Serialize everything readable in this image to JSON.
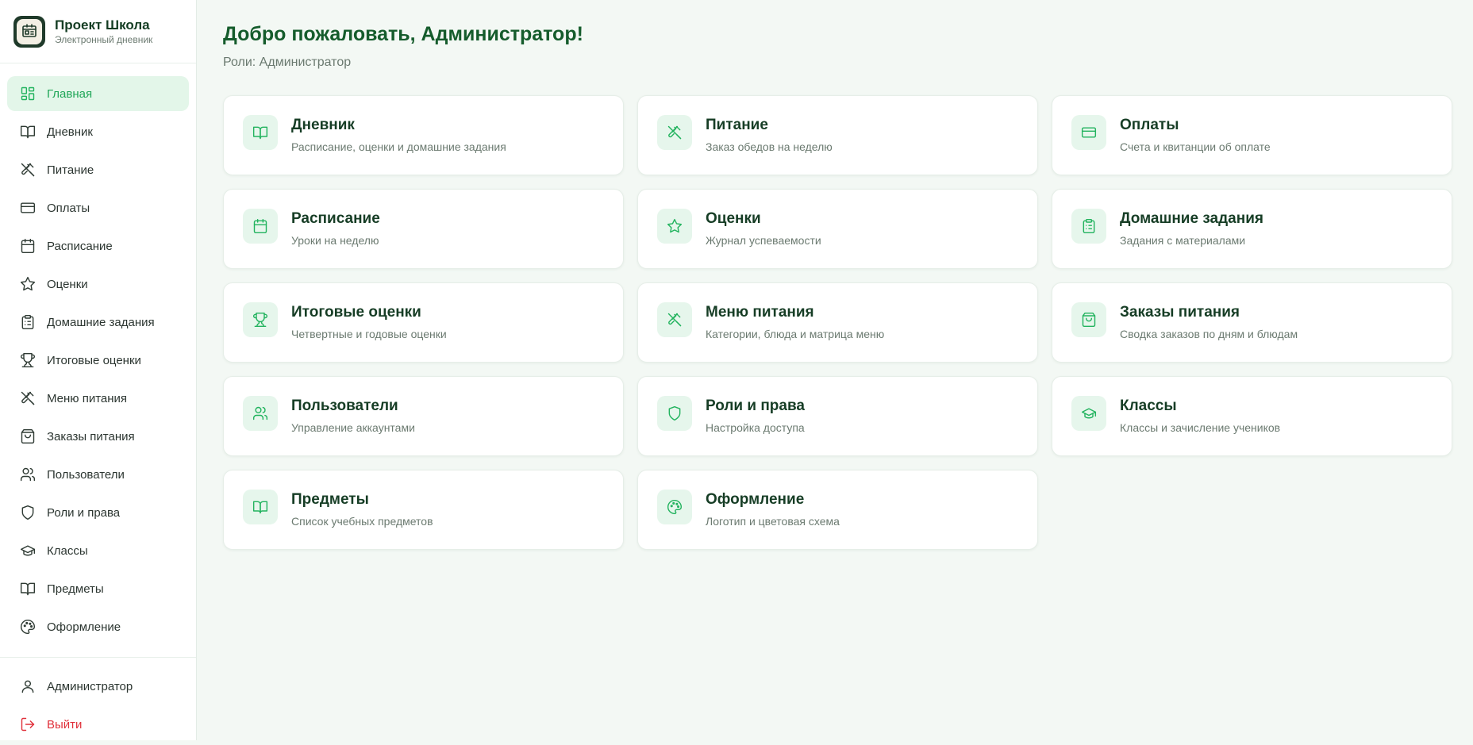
{
  "brand": {
    "title": "Проект Школа",
    "subtitle": "Электронный дневник"
  },
  "sidebar": {
    "items": [
      {
        "label": "Главная",
        "icon": "dashboard-icon",
        "active": true
      },
      {
        "label": "Дневник",
        "icon": "book-icon"
      },
      {
        "label": "Питание",
        "icon": "utensils-icon"
      },
      {
        "label": "Оплаты",
        "icon": "credit-card-icon"
      },
      {
        "label": "Расписание",
        "icon": "calendar-icon"
      },
      {
        "label": "Оценки",
        "icon": "star-icon"
      },
      {
        "label": "Домашние задания",
        "icon": "clipboard-icon"
      },
      {
        "label": "Итоговые оценки",
        "icon": "trophy-icon"
      },
      {
        "label": "Меню питания",
        "icon": "utensils-icon"
      },
      {
        "label": "Заказы питания",
        "icon": "shopping-bag-icon"
      },
      {
        "label": "Пользователи",
        "icon": "users-icon"
      },
      {
        "label": "Роли и права",
        "icon": "shield-icon"
      },
      {
        "label": "Классы",
        "icon": "graduation-cap-icon"
      },
      {
        "label": "Предметы",
        "icon": "book-icon"
      },
      {
        "label": "Оформление",
        "icon": "palette-icon"
      }
    ],
    "user_label": "Администратор",
    "logout_label": "Выйти"
  },
  "main": {
    "title": "Добро пожаловать, Администратор!",
    "roles": "Роли: Администратор",
    "cards": [
      {
        "title": "Дневник",
        "desc": "Расписание, оценки и домашние задания",
        "icon": "book-icon"
      },
      {
        "title": "Питание",
        "desc": "Заказ обедов на неделю",
        "icon": "utensils-icon"
      },
      {
        "title": "Оплаты",
        "desc": "Счета и квитанции об оплате",
        "icon": "credit-card-icon"
      },
      {
        "title": "Расписание",
        "desc": "Уроки на неделю",
        "icon": "calendar-icon"
      },
      {
        "title": "Оценки",
        "desc": "Журнал успеваемости",
        "icon": "star-icon"
      },
      {
        "title": "Домашние задания",
        "desc": "Задания с материалами",
        "icon": "clipboard-icon"
      },
      {
        "title": "Итоговые оценки",
        "desc": "Четвертные и годовые оценки",
        "icon": "trophy-icon"
      },
      {
        "title": "Меню питания",
        "desc": "Категории, блюда и матрица меню",
        "icon": "utensils-icon"
      },
      {
        "title": "Заказы питания",
        "desc": "Сводка заказов по дням и блюдам",
        "icon": "shopping-bag-icon"
      },
      {
        "title": "Пользователи",
        "desc": "Управление аккаунтами",
        "icon": "users-icon"
      },
      {
        "title": "Роли и права",
        "desc": "Настройка доступа",
        "icon": "shield-icon"
      },
      {
        "title": "Классы",
        "desc": "Классы и зачисление учеников",
        "icon": "graduation-cap-icon"
      },
      {
        "title": "Предметы",
        "desc": "Список учебных предметов",
        "icon": "book-icon"
      },
      {
        "title": "Оформление",
        "desc": "Логотип и цветовая схема",
        "icon": "palette-icon"
      }
    ]
  },
  "colors": {
    "accent": "#22b35e",
    "heading": "#155c2c",
    "danger": "#e0303a",
    "background": "#f3f8f4"
  }
}
